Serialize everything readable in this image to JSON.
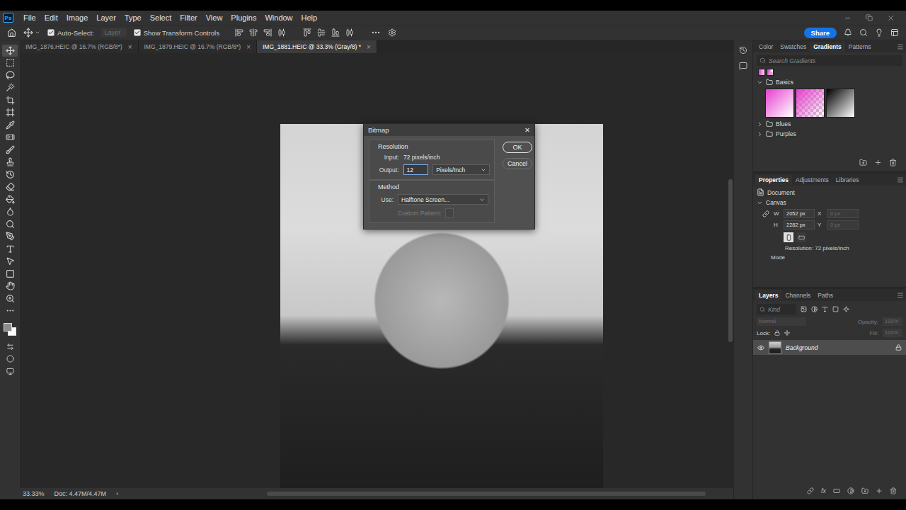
{
  "menu_bar": {
    "logo": "Ps",
    "items": [
      "File",
      "Edit",
      "Image",
      "Layer",
      "Type",
      "Select",
      "Filter",
      "View",
      "Plugins",
      "Window",
      "Help"
    ]
  },
  "options_bar": {
    "auto_select": {
      "label": "Auto-Select:",
      "checked": true
    },
    "target": {
      "value": "Layer",
      "disabled": true
    },
    "transform_controls": {
      "label": "Show Transform Controls",
      "checked": true
    },
    "share": "Share"
  },
  "document_tabs": [
    {
      "label": "IMG_1876.HEIC @ 16.7% (RGB/8*)",
      "selected": false,
      "close": "×"
    },
    {
      "label": "IMG_1879.HEIC @ 16.7% (RGB/8*)",
      "selected": false,
      "close": "×"
    },
    {
      "label": "IMG_1881.HEIC @ 33.3% (Gray/8) *",
      "selected": true,
      "close": "×"
    }
  ],
  "toolbar": {
    "tools": [
      {
        "selected": true
      },
      {
        "selected": false
      },
      {
        "selected": false
      },
      {
        "selected": false
      },
      {
        "selected": false
      },
      {
        "selected": false
      },
      {
        "selected": false
      },
      {
        "selected": false
      },
      {
        "selected": false
      },
      {
        "selected": false
      },
      {
        "selected": false
      },
      {
        "selected": false
      },
      {
        "selected": false
      },
      {
        "selected": false
      },
      {
        "selected": false
      },
      {
        "selected": false
      },
      {
        "selected": false
      },
      {
        "selected": false
      },
      {
        "selected": false
      },
      {
        "selected": false
      },
      {
        "selected": false
      },
      {
        "selected": false
      }
    ],
    "foreground": "#8c8c8c",
    "background": "#ffffff"
  },
  "dialog": {
    "title": "Bitmap",
    "close": "✕",
    "resolution": {
      "legend": "Resolution",
      "input_label": "Input:",
      "input_value": "72 pixels/inch",
      "output_label": "Output:",
      "output_value": "12",
      "unit": "Pixels/Inch"
    },
    "method": {
      "legend": "Method",
      "use_label": "Use:",
      "use_value": "Halftone Screen...",
      "custom_pattern": {
        "label": "Custom Pattern:",
        "disabled": true
      }
    },
    "buttons": [
      {
        "label": "OK",
        "default": true
      },
      {
        "label": "Cancel",
        "default": false
      }
    ]
  },
  "status_bar": {
    "zoom": "33.33%",
    "doc": "Doc: 4.47M/4.47M",
    "arrow": "›"
  },
  "gradients_panel": {
    "tabs": [
      {
        "label": "Color",
        "selected": false
      },
      {
        "label": "Swatches",
        "selected": false
      },
      {
        "label": "Gradients",
        "selected": true
      },
      {
        "label": "Patterns",
        "selected": false
      }
    ],
    "search_placeholder": "Search Gradients",
    "recent": [
      {
        "colors": [
          "#e83fcf",
          "#ffd6f5"
        ],
        "transparent": false
      },
      {
        "colors": [
          "#e83fcf",
          "#e83fcf00"
        ],
        "transparent": true
      }
    ],
    "groups": [
      {
        "name": "Basics",
        "expanded": true,
        "gradients": [
          {
            "colors": [
              "#e83fcf",
              "#ffffff"
            ],
            "transparent": false
          },
          {
            "colors": [
              "#e83fcf",
              "#e83fcf00"
            ],
            "transparent": true
          },
          {
            "colors": [
              "#000000",
              "#ffffff"
            ],
            "transparent": false
          }
        ]
      },
      {
        "name": "Blues",
        "expanded": false,
        "gradients": []
      },
      {
        "name": "Purples",
        "expanded": false,
        "gradients": []
      }
    ]
  },
  "properties_panel": {
    "tabs": [
      {
        "label": "Properties",
        "selected": true
      },
      {
        "label": "Adjustments",
        "selected": false
      },
      {
        "label": "Libraries",
        "selected": false
      }
    ],
    "document_label": "Document",
    "section": {
      "title": "Canvas",
      "expanded": true
    },
    "fields": [
      {
        "label": "W",
        "value": "2052 px",
        "disabled": false
      },
      {
        "label": "X",
        "value": "0 px",
        "disabled": true
      },
      {
        "label": "H",
        "value": "2282 px",
        "disabled": false
      },
      {
        "label": "Y",
        "value": "0 px",
        "disabled": true
      }
    ],
    "orientation": [
      {
        "kind": "portrait",
        "selected": true
      },
      {
        "kind": "landscape",
        "selected": false
      }
    ],
    "resolution": "Resolution: 72 pixels/inch",
    "mode_label": "Mode"
  },
  "layers_panel": {
    "tabs": [
      {
        "label": "Layers",
        "selected": true
      },
      {
        "label": "Channels",
        "selected": false
      },
      {
        "label": "Paths",
        "selected": false
      }
    ],
    "filter_placeholder": "Kind",
    "blend_mode": {
      "value": "Normal",
      "disabled": true
    },
    "opacity": {
      "label": "Opacity:",
      "value": "100%",
      "disabled": true
    },
    "lock_label": "Lock:",
    "fill": {
      "label": "Fill:",
      "value": "100%",
      "disabled": true
    },
    "layers": [
      {
        "name": "Background",
        "visible": true,
        "locked": true,
        "selected": true
      }
    ],
    "fx_label": "fx"
  }
}
